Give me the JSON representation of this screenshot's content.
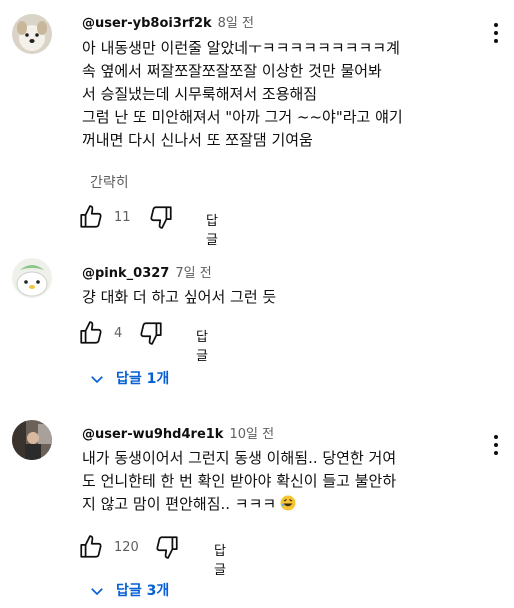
{
  "comments": [
    {
      "author": "@user-yb8oi3rf2k",
      "time": "8일 전",
      "lines": [
        "아 내동생만 이런줄 알았네ㅜㅋㅋㅋㅋㅋㅋㅋㅋㅋ계",
        "속 옆에서 쩌잘쪼잘쪼잘쪼잘 이상한 것만 물어봐",
        "서 승질냈는데 시무룩해져서 조용해짐",
        "그럼 난 또 미안해져서 \"아까 그거 ~~야\"라고 얘기",
        "꺼내면 다시 신나서 또 쪼잘댐 기여움"
      ],
      "more_label": "간략히",
      "likes": "11",
      "reply_label": "답글"
    },
    {
      "author": "@pink_0327",
      "time": "7일 전",
      "lines": [
        "걍 대화 더 하고 싶어서 그런 듯"
      ],
      "likes": "4",
      "reply_label": "답글",
      "replies_label": "답글 1개"
    },
    {
      "author": "@user-wu9hd4re1k",
      "time": "10일 전",
      "lines": [
        "내가 동생이어서 그런지 동생 이해됨.. 당연한 거여",
        "도 언니한테 한 번 확인 받아야 확신이 들고 불안하",
        "지 않고 맘이 편안해짐.. ㅋㅋㅋ"
      ],
      "emoji": "rolling-on-floor-laughing",
      "likes": "120",
      "reply_label": "답글",
      "replies_label": "답글 3개"
    }
  ],
  "icons": {
    "like": "thumb-up-icon",
    "dislike": "thumb-down-icon",
    "menu": "more-vert-icon",
    "expand": "chevron-down-icon"
  },
  "colors": {
    "text": "#0f0f0f",
    "secondary": "#606060",
    "link": "#065fd4"
  }
}
